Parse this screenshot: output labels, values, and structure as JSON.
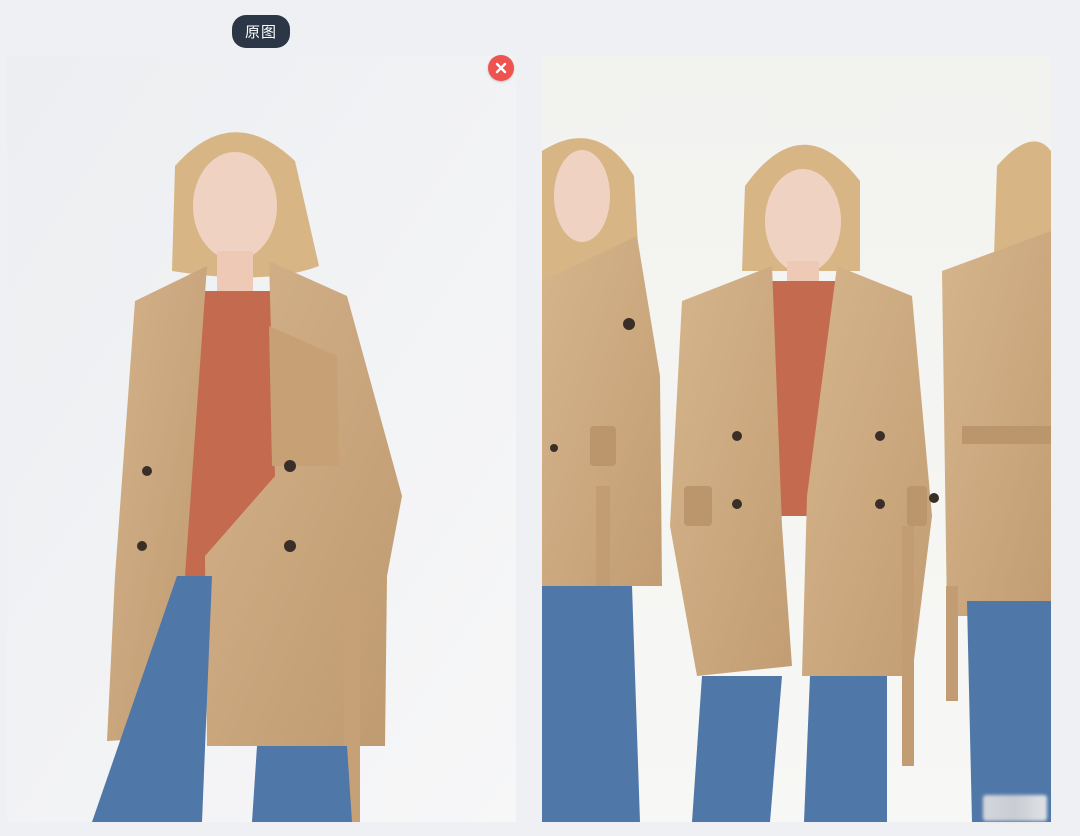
{
  "header": {
    "badge_label": "原图"
  },
  "colors": {
    "page_background": "#eef0f3",
    "badge_background": "#2b3746",
    "close_button": "#ef5350",
    "coat": "#c9a57c",
    "top": "#c46a4e",
    "jeans": "#4f77a8"
  },
  "left_panel": {
    "role": "original-image"
  },
  "right_panel": {
    "role": "generated-image"
  },
  "icons": {
    "close": "close-icon"
  }
}
